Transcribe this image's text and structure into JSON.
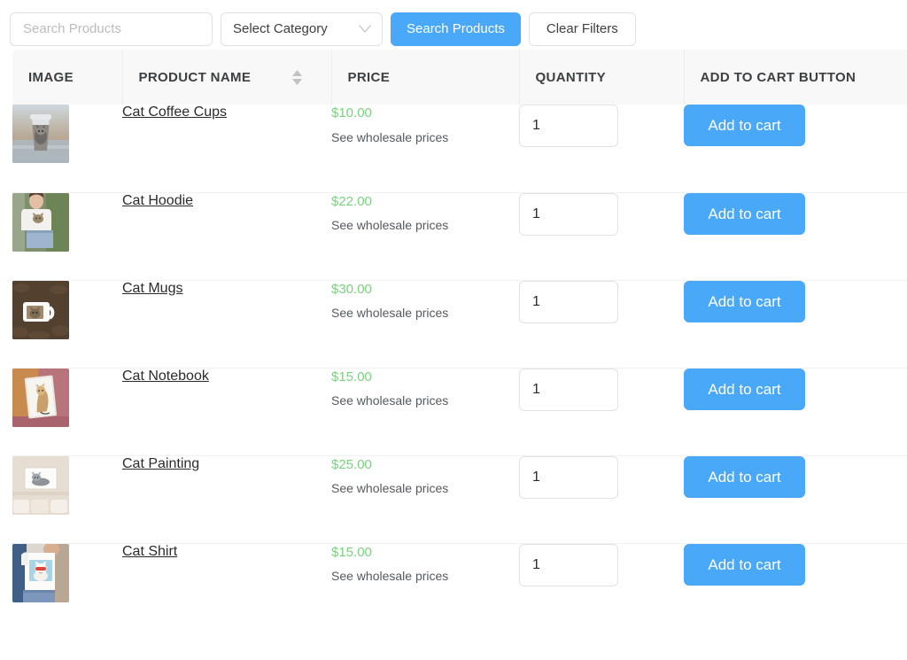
{
  "toolbar": {
    "search_placeholder": "Search Products",
    "search_value": "",
    "category_selected": "Select Category",
    "category_options": [
      "Select Category"
    ],
    "search_button_label": "Search Products",
    "clear_button_label": "Clear Filters",
    "chevron_icon": "chevron-down-icon",
    "primary_color": "#49a8f8",
    "border_color": "#dfe1e5"
  },
  "table": {
    "columns": [
      {
        "label": "IMAGE",
        "sortable": false
      },
      {
        "label": "PRODUCT NAME",
        "sortable": true,
        "sort_icon": "sort-arrows-icon"
      },
      {
        "label": "PRICE",
        "sortable": false
      },
      {
        "label": "QUANTITY",
        "sortable": false
      },
      {
        "label": "ADD TO CART BUTTON",
        "sortable": false
      }
    ],
    "header_background": "#f8f8f8",
    "price_color": "#7ad17f",
    "rows": [
      {
        "name": "Cat Coffee Cups",
        "price": "$10.00",
        "wholesale_text": "See wholesale prices",
        "quantity": "1",
        "add_to_cart_label": "Add to cart",
        "image_alt": "cat-coffee-cup-thumbnail"
      },
      {
        "name": "Cat Hoodie",
        "price": "$22.00",
        "wholesale_text": "See wholesale prices",
        "quantity": "1",
        "add_to_cart_label": "Add to cart",
        "image_alt": "cat-hoodie-thumbnail"
      },
      {
        "name": "Cat Mugs",
        "price": "$30.00",
        "wholesale_text": "See wholesale prices",
        "quantity": "1",
        "add_to_cart_label": "Add to cart",
        "image_alt": "cat-mug-thumbnail"
      },
      {
        "name": "Cat Notebook",
        "price": "$15.00",
        "wholesale_text": "See wholesale prices",
        "quantity": "1",
        "add_to_cart_label": "Add to cart",
        "image_alt": "cat-notebook-thumbnail"
      },
      {
        "name": "Cat Painting",
        "price": "$25.00",
        "wholesale_text": "See wholesale prices",
        "quantity": "1",
        "add_to_cart_label": "Add to cart",
        "image_alt": "cat-painting-thumbnail"
      },
      {
        "name": "Cat Shirt",
        "price": "$15.00",
        "wholesale_text": "See wholesale prices",
        "quantity": "1",
        "add_to_cart_label": "Add to cart",
        "image_alt": "cat-shirt-thumbnail"
      }
    ]
  }
}
